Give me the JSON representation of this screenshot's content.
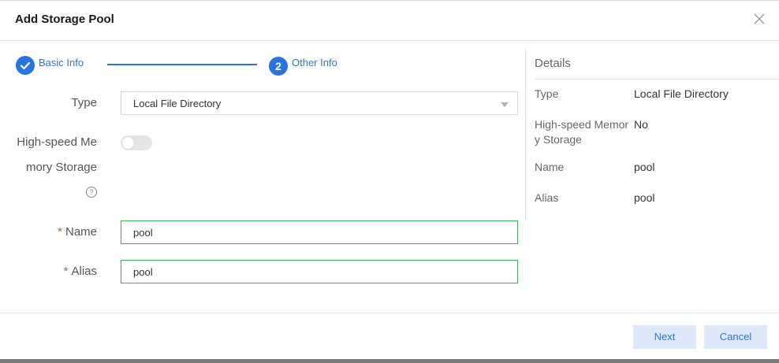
{
  "dialog": {
    "title": "Add Storage Pool"
  },
  "steps": [
    {
      "number": "✓",
      "label": "Basic Info"
    },
    {
      "number": "2",
      "label": "Other Info"
    }
  ],
  "form": {
    "type": {
      "label": "Type",
      "value": "Local File Directory"
    },
    "memory_storage": {
      "label_line1": "High-speed Me",
      "label_line2": "mory Storage",
      "help": "?",
      "enabled": false
    },
    "name": {
      "required_mark": "*",
      "label": "Name",
      "value": "pool"
    },
    "alias": {
      "required_mark": "*",
      "label": "Alias",
      "value": "pool"
    }
  },
  "details": {
    "title": "Details",
    "rows": [
      {
        "key": "Type",
        "value": "Local File Directory"
      },
      {
        "key": "High-speed Memory Storage",
        "value": "No"
      },
      {
        "key": "Name",
        "value": "pool"
      },
      {
        "key": "Alias",
        "value": "pool"
      }
    ]
  },
  "footer": {
    "next_label": "Next",
    "cancel_label": "Cancel"
  },
  "colors": {
    "accent": "#2b74e0",
    "valid": "#3fae5a",
    "required": "#e64545"
  }
}
